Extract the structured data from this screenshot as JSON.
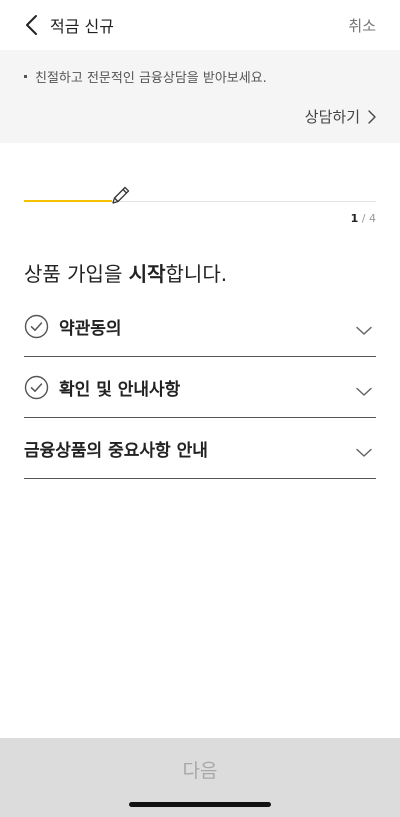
{
  "header": {
    "title": "적금 신규",
    "cancel_label": "취소"
  },
  "notice": {
    "text": "친절하고 전문적인 금융상담을 받아보세요.",
    "consult_label": "상담하기"
  },
  "progress": {
    "current": "1",
    "separator": "/",
    "total": "4",
    "fraction": 0.25
  },
  "heading": {
    "prefix": "상품 가입을 ",
    "emphasis": "시작",
    "suffix": "합니다."
  },
  "sections": [
    {
      "label": "약관동의",
      "has_check": true
    },
    {
      "label": "확인 및 안내사항",
      "has_check": true
    },
    {
      "label": "금융상품의 중요사항 안내",
      "has_check": false
    }
  ],
  "footer": {
    "next_label": "다음"
  },
  "colors": {
    "accent": "#f5c000",
    "banner_bg": "#f5f5f6",
    "button_bg": "#dcdcdc",
    "button_text_disabled": "#a8a8a8"
  },
  "icons": [
    "back-chevron-icon",
    "chevron-right-icon",
    "pencil-icon",
    "check-circle-icon",
    "chevron-down-icon"
  ]
}
